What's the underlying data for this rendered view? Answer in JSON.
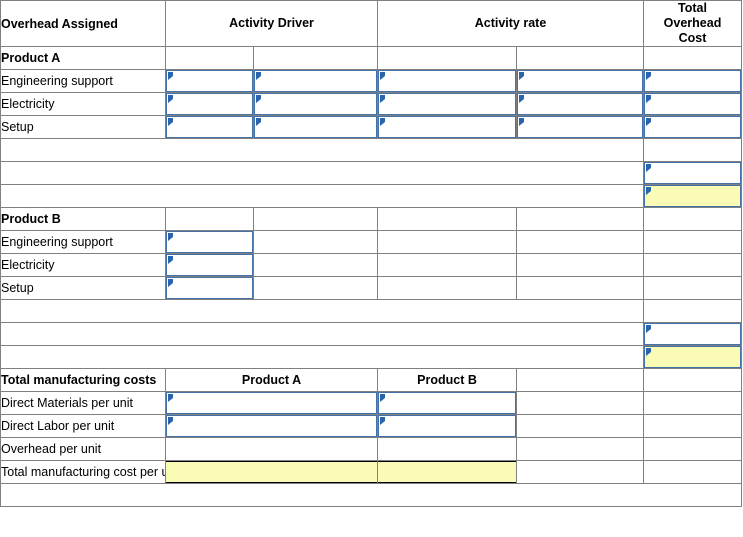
{
  "worksheet": {
    "columns": {
      "overhead_assigned": "Overhead Assigned",
      "activity_driver": "Activity Driver",
      "activity_rate": "Activity rate",
      "total_overhead_cost": "Total\nOverhead\nCost",
      "total_overhead_cost_line1": "Total",
      "total_overhead_cost_line2": "Overhead",
      "total_overhead_cost_line3": "Cost"
    },
    "product_a": {
      "title": "Product A",
      "items": [
        {
          "label": "Engineering support"
        },
        {
          "label": "Electricity"
        },
        {
          "label": "Setup"
        }
      ]
    },
    "product_b": {
      "title": "Product B",
      "items": [
        {
          "label": "Engineering support"
        },
        {
          "label": "Electricity"
        },
        {
          "label": "Setup"
        }
      ]
    },
    "totals_table": {
      "title": "Total manufacturing costs",
      "col_product_a": "Product A",
      "col_product_b": "Product B",
      "rows": [
        {
          "label": "Direct Materials per unit"
        },
        {
          "label": "Direct Labor per unit"
        },
        {
          "label": "Overhead per unit"
        },
        {
          "label": "Total manufacturing cost per unit"
        }
      ]
    },
    "colors": {
      "header_fill": "#AFBEDC",
      "input_border": "#4472A8",
      "answer_fill": "#FAFBB4",
      "grid_line": "#808080",
      "marker": "#2A64AD"
    }
  }
}
